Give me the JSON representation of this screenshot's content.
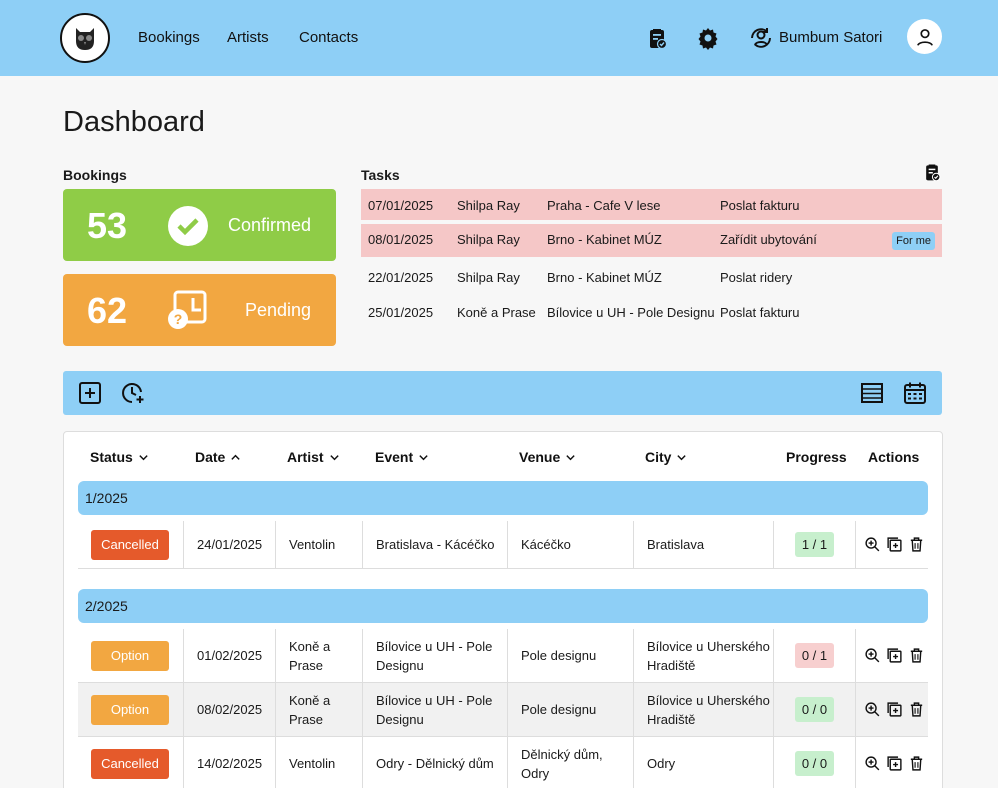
{
  "nav": {
    "links": [
      "Bookings",
      "Artists",
      "Contacts"
    ],
    "user_name": "Bumbum Satori"
  },
  "page_title": "Dashboard",
  "bookings": {
    "label": "Bookings",
    "confirmed": {
      "count": "53",
      "label": "Confirmed",
      "color": "#8fcc47"
    },
    "pending": {
      "count": "62",
      "label": "Pending",
      "color": "#f2a741"
    }
  },
  "tasks": {
    "label": "Tasks",
    "rows": [
      {
        "date": "07/01/2025",
        "artist": "Shilpa Ray",
        "event": "Praha - Cafe V lese",
        "task": "Poslat fakturu",
        "badge": ""
      },
      {
        "date": "08/01/2025",
        "artist": "Shilpa Ray",
        "event": "Brno - Kabinet MÚZ",
        "task": "Zařídit ubytování",
        "badge": "For me"
      },
      {
        "date": "22/01/2025",
        "artist": "Shilpa Ray",
        "event": "Brno - Kabinet MÚZ",
        "task": "Poslat ridery",
        "badge": ""
      },
      {
        "date": "25/01/2025",
        "artist": "Koně a Prase",
        "event": "Bílovice u UH - Pole Designu",
        "task": "Poslat fakturu",
        "badge": ""
      }
    ]
  },
  "table": {
    "headers": {
      "status": "Status",
      "date": "Date",
      "artist": "Artist",
      "event": "Event",
      "venue": "Venue",
      "city": "City",
      "progress": "Progress",
      "actions": "Actions"
    },
    "groups": [
      {
        "label": "1/2025"
      },
      {
        "label": "2/2025"
      }
    ],
    "rows": [
      {
        "status": "Cancelled",
        "date": "24/01/2025",
        "artist": "Ventolin",
        "event": "Bratislava - Kácéčko",
        "venue": "Kácéčko",
        "city": "Bratislava",
        "progress": "1 / 1"
      },
      {
        "status": "Option",
        "date": "01/02/2025",
        "artist": "Koně a Prase",
        "event": "Bílovice u UH - Pole Designu",
        "venue": "Pole designu",
        "city": "Bílovice u Uherského Hradiště",
        "progress": "0 / 1"
      },
      {
        "status": "Option",
        "date": "08/02/2025",
        "artist": "Koně a Prase",
        "event": "Bílovice u UH - Pole Designu",
        "venue": "Pole designu",
        "city": "Bílovice u Uherského Hradiště",
        "progress": "0 / 0"
      },
      {
        "status": "Cancelled",
        "date": "14/02/2025",
        "artist": "Ventolin",
        "event": "Odry - Dělnický dům",
        "venue": "Dělnický dům, Odry",
        "city": "Odry",
        "progress": "0 / 0"
      }
    ]
  },
  "colors": {
    "accent": "#8ecff6",
    "cancelled": "#e55a2b",
    "option": "#f2a741",
    "task_highlight": "#f5c7c7"
  }
}
